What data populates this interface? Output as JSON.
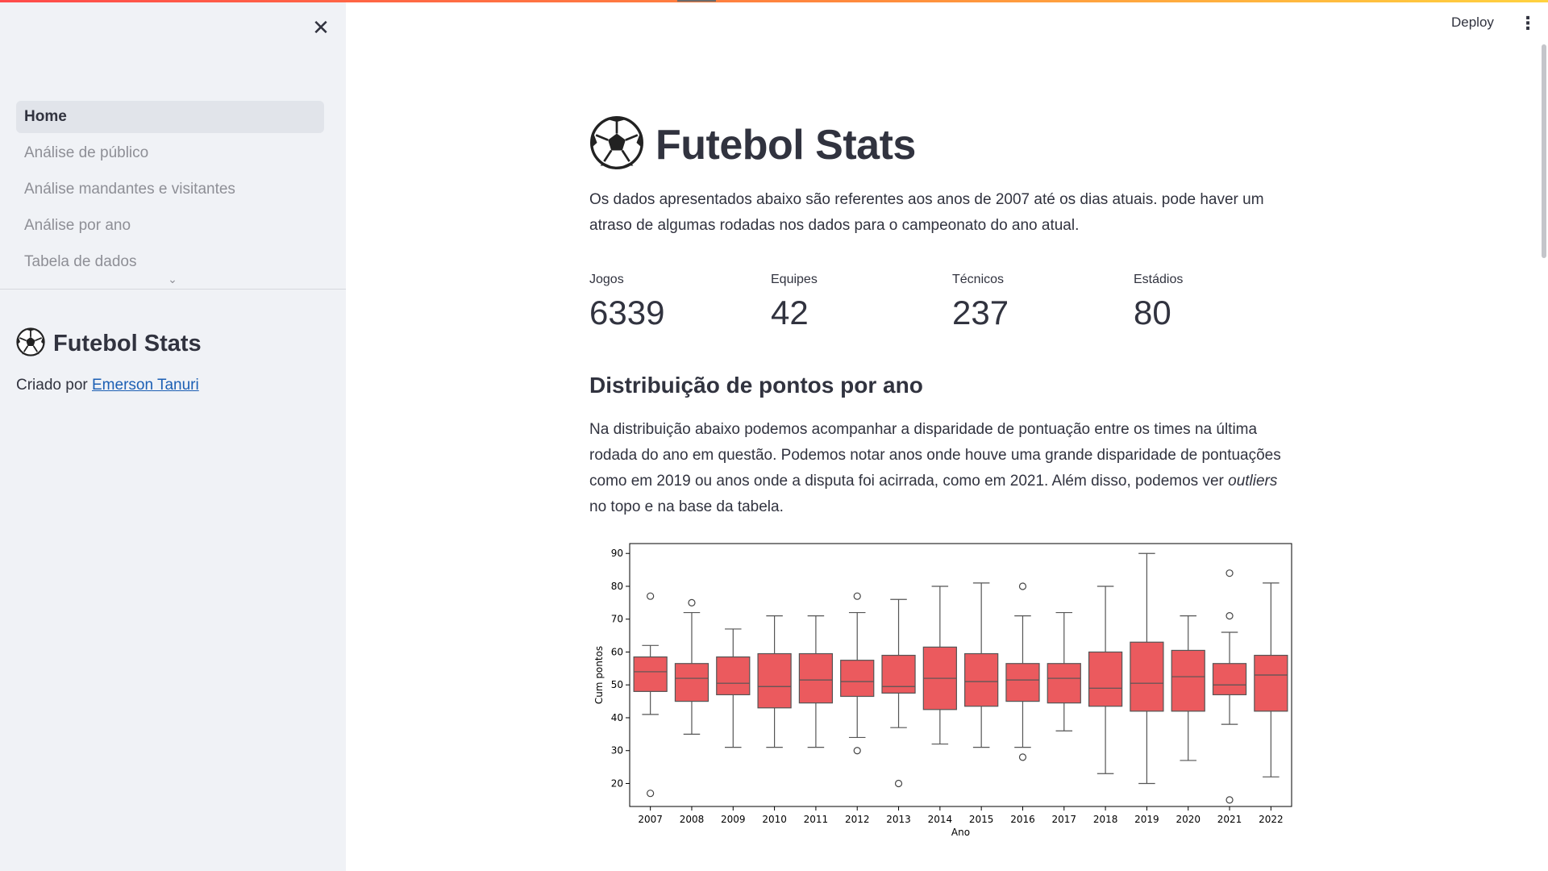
{
  "sidebar": {
    "nav_items": [
      {
        "label": "Home",
        "active": true
      },
      {
        "label": "Análise de público",
        "active": false
      },
      {
        "label": "Análise mandantes e visitantes",
        "active": false
      },
      {
        "label": "Análise por ano",
        "active": false
      },
      {
        "label": "Tabela de dados",
        "active": false
      }
    ],
    "brand_title": "Futebol Stats",
    "credit_prefix": "Criado por",
    "credit_link": "Emerson Tanuri"
  },
  "header": {
    "deploy_label": "Deploy"
  },
  "main": {
    "title": "Futebol Stats",
    "intro": "Os dados apresentados abaixo são referentes aos anos de 2007 até os dias atuais. pode haver um atraso de algumas rodadas nos dados para o campeonato do ano atual.",
    "metrics": [
      {
        "label": "Jogos",
        "value": "6339"
      },
      {
        "label": "Equipes",
        "value": "42"
      },
      {
        "label": "Técnicos",
        "value": "237"
      },
      {
        "label": "Estádios",
        "value": "80"
      }
    ],
    "section_title": "Distribuição de pontos por ano",
    "section_text_1": "Na distribuição abaixo podemos acompanhar a disparidade de pontuação entre os times na última rodada do ano em questão. Podemos notar anos onde houve uma grande disparidade de pontuações como em 2019 ou anos onde a disputa foi acirrada, como em 2021. Além disso, podemos ver",
    "section_text_em": "outliers",
    "section_text_2": "no topo e na base da tabela."
  },
  "colors": {
    "accent": "#ff4b4b",
    "box_fill": "#eb5a5e",
    "link": "#1c5fb4",
    "sidebar_bg": "#f0f2f6"
  },
  "icons": [
    "close-icon",
    "soccer-ball-icon",
    "chevron-down-icon",
    "more-vertical-icon"
  ],
  "chart_data": {
    "type": "boxplot",
    "xlabel": "Ano",
    "ylabel": "Cum pontos",
    "ylim": [
      13,
      93
    ],
    "yticks": [
      20,
      30,
      40,
      50,
      60,
      70,
      80,
      90
    ],
    "categories": [
      "2007",
      "2008",
      "2009",
      "2010",
      "2011",
      "2012",
      "2013",
      "2014",
      "2015",
      "2016",
      "2017",
      "2018",
      "2019",
      "2020",
      "2021",
      "2022"
    ],
    "boxes": [
      {
        "min": 41,
        "q1": 48,
        "median": 54,
        "q3": 58.5,
        "max": 62,
        "outliers": [
          77,
          17
        ]
      },
      {
        "min": 35,
        "q1": 45,
        "median": 52,
        "q3": 56.5,
        "max": 72,
        "outliers": [
          75
        ]
      },
      {
        "min": 31,
        "q1": 47,
        "median": 50.5,
        "q3": 58.5,
        "max": 67,
        "outliers": []
      },
      {
        "min": 31,
        "q1": 43,
        "median": 49.5,
        "q3": 59.5,
        "max": 71,
        "outliers": []
      },
      {
        "min": 31,
        "q1": 44.5,
        "median": 51.5,
        "q3": 59.5,
        "max": 71,
        "outliers": []
      },
      {
        "min": 34,
        "q1": 46.5,
        "median": 51,
        "q3": 57.5,
        "max": 72,
        "outliers": [
          77,
          30
        ]
      },
      {
        "min": 37,
        "q1": 47.5,
        "median": 49.5,
        "q3": 59,
        "max": 76,
        "outliers": [
          20
        ]
      },
      {
        "min": 32,
        "q1": 42.5,
        "median": 52,
        "q3": 61.5,
        "max": 80,
        "outliers": []
      },
      {
        "min": 31,
        "q1": 43.5,
        "median": 51,
        "q3": 59.5,
        "max": 81,
        "outliers": []
      },
      {
        "min": 31,
        "q1": 45,
        "median": 51.5,
        "q3": 56.5,
        "max": 71,
        "outliers": [
          80,
          28
        ]
      },
      {
        "min": 36,
        "q1": 44.5,
        "median": 52,
        "q3": 56.5,
        "max": 72,
        "outliers": []
      },
      {
        "min": 23,
        "q1": 43.5,
        "median": 49,
        "q3": 60,
        "max": 80,
        "outliers": []
      },
      {
        "min": 20,
        "q1": 42,
        "median": 50.5,
        "q3": 63,
        "max": 90,
        "outliers": []
      },
      {
        "min": 27,
        "q1": 42,
        "median": 52.5,
        "q3": 60.5,
        "max": 71,
        "outliers": []
      },
      {
        "min": 38,
        "q1": 47,
        "median": 50,
        "q3": 56.5,
        "max": 66,
        "outliers": [
          84,
          71,
          15
        ]
      },
      {
        "min": 22,
        "q1": 42,
        "median": 53,
        "q3": 59,
        "max": 81,
        "outliers": []
      }
    ]
  }
}
